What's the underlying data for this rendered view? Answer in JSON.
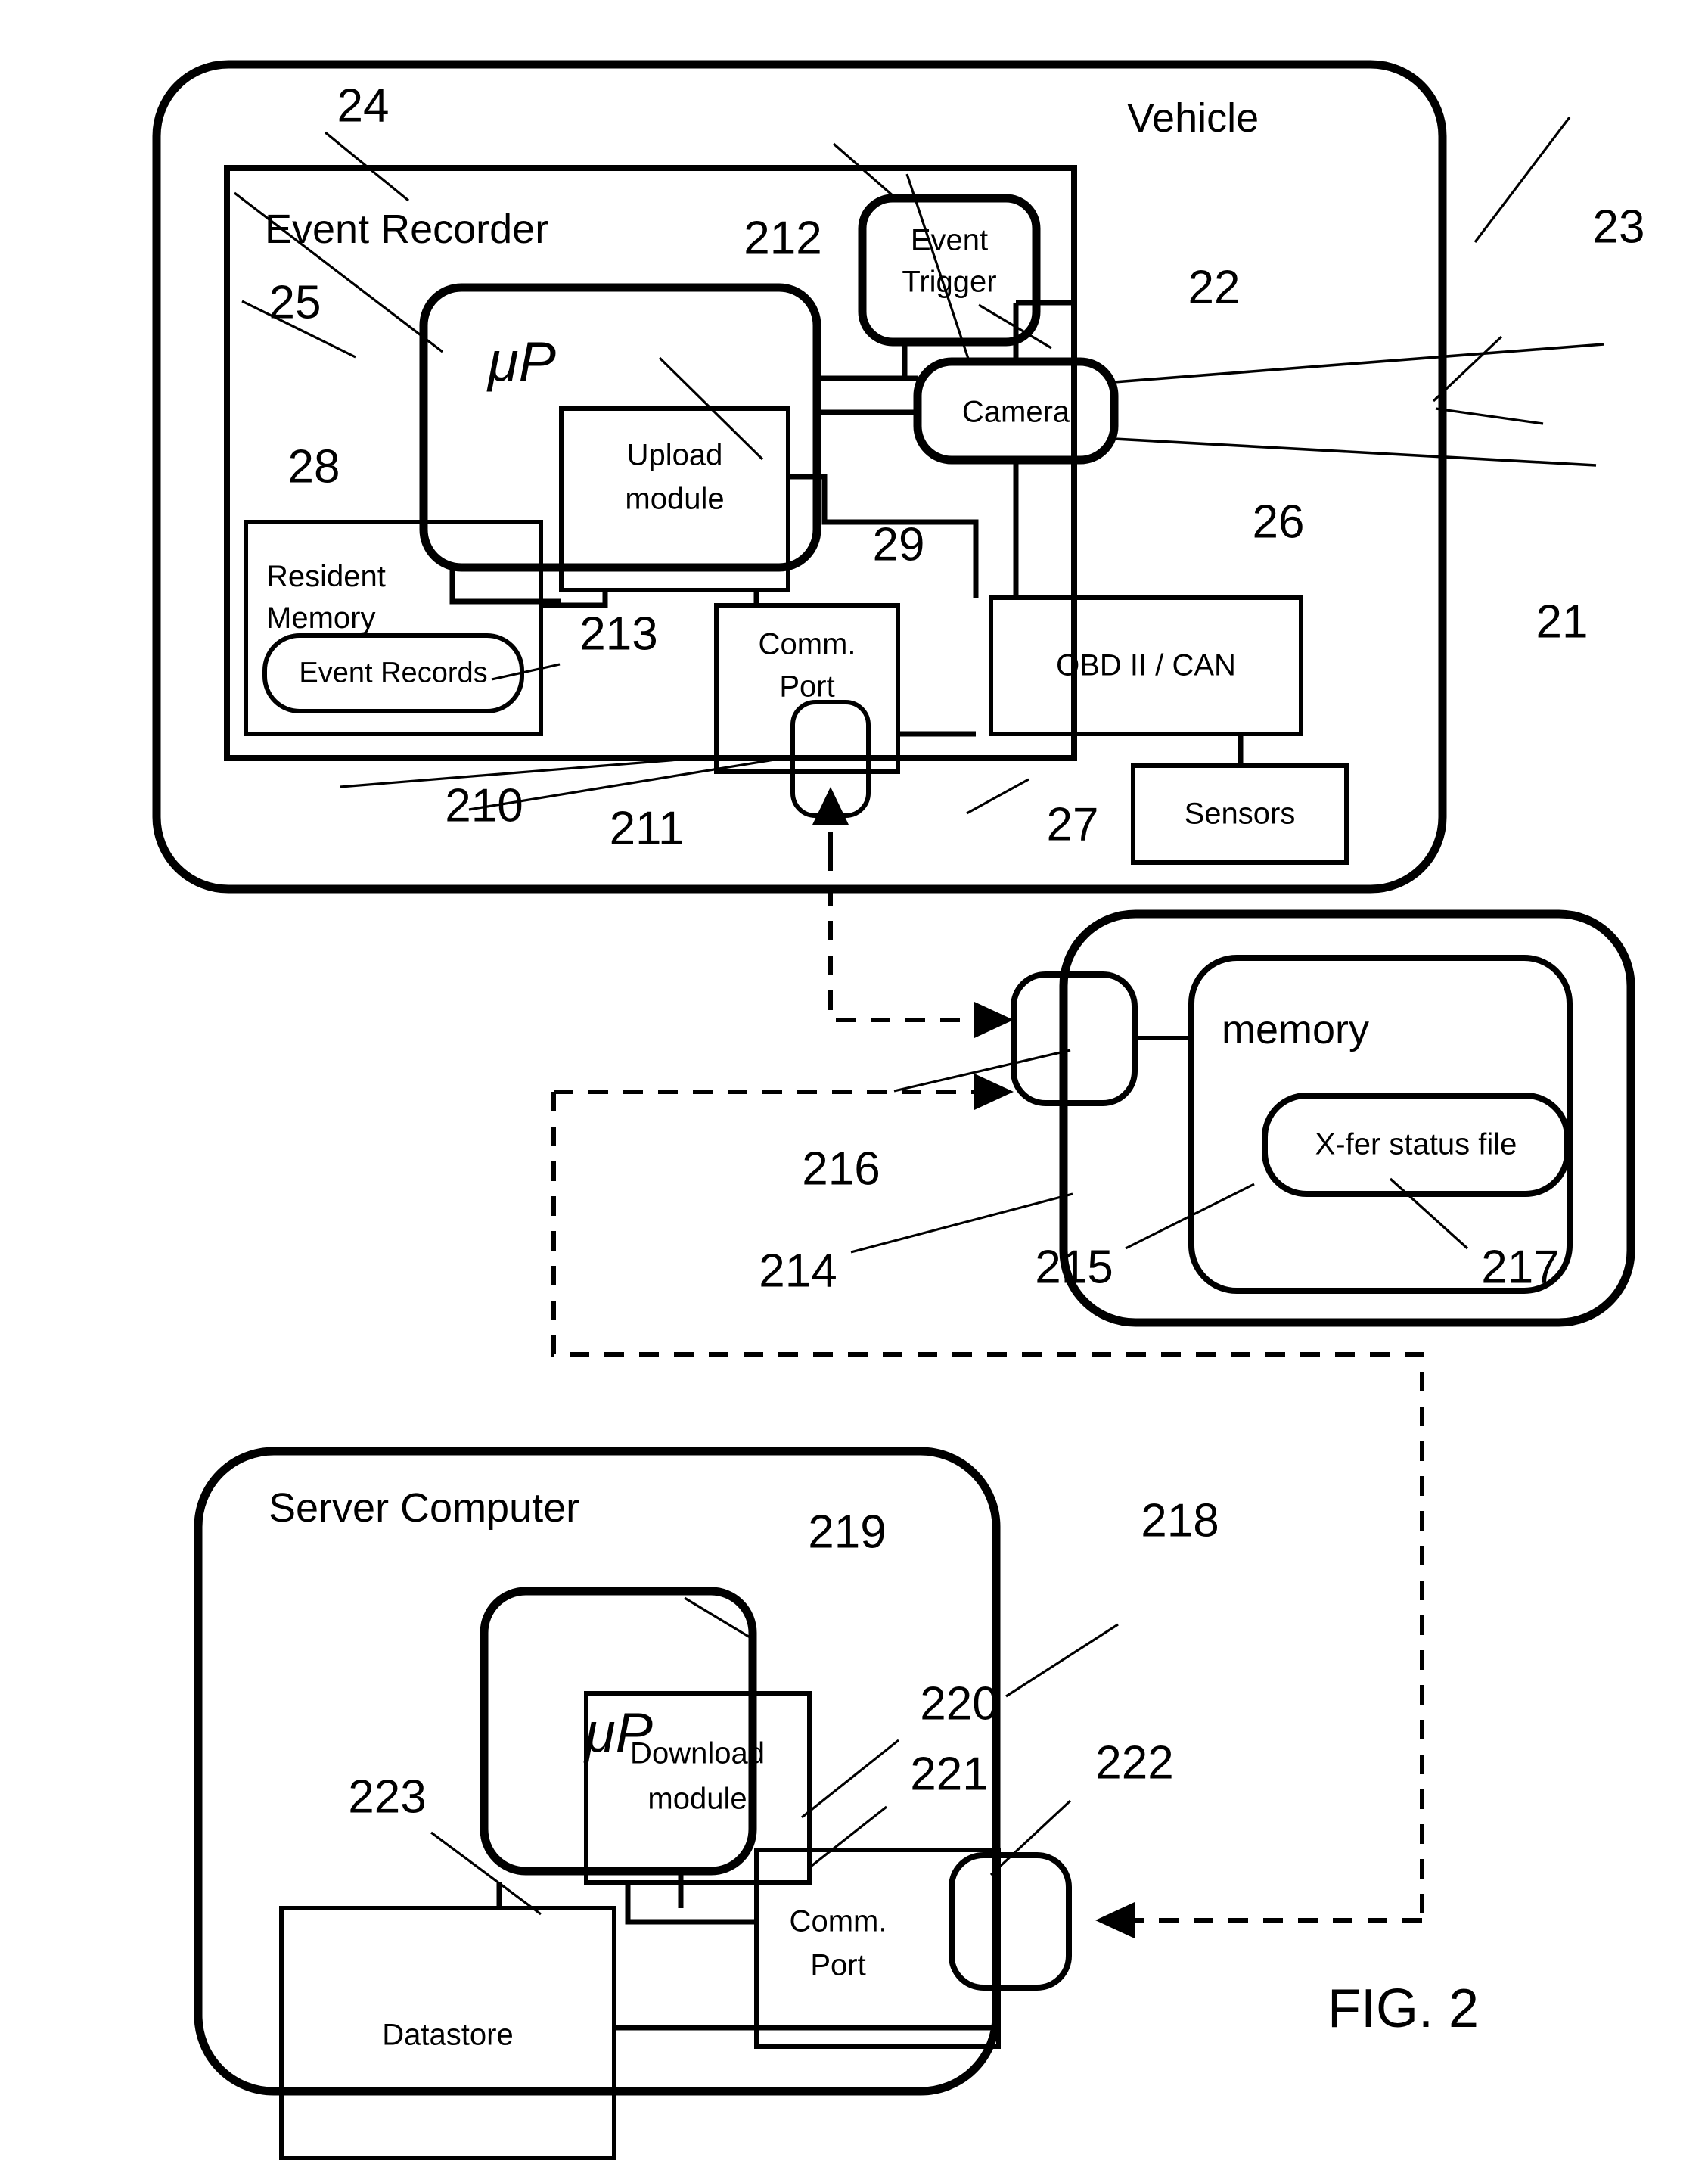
{
  "figure": {
    "caption": "FIG. 2",
    "vehicle": {
      "title": "Vehicle",
      "ref_vehicle": "21",
      "ref_fov": "23",
      "event_recorder": {
        "title": "Event Recorder",
        "ref": "24",
        "blocks": {
          "processor": {
            "label": "μP",
            "ref": "25"
          },
          "event_trigger": {
            "label_line1": "Event",
            "label_line2": "Trigger",
            "ref": "212"
          },
          "upload_module": {
            "label_line1": "Upload",
            "label_line2": "module",
            "ref": "29"
          },
          "resident_memory": {
            "label_line1": "Resident",
            "label_line2": "Memory",
            "ref": "28"
          },
          "event_records": {
            "label": "Event Records",
            "ref": "213"
          },
          "comm_port": {
            "label_line1": "Comm.",
            "label_line2": "Port",
            "ref": "210"
          },
          "comm_port_connector": {
            "ref": "211"
          }
        }
      },
      "camera": {
        "label": "Camera",
        "ref": "22"
      },
      "obd": {
        "label": "OBD II / CAN",
        "ref": "26"
      },
      "sensors": {
        "label": "Sensors",
        "ref": "27"
      }
    },
    "mobile_device": {
      "ref": "214",
      "memory": {
        "label": "memory",
        "ref": "215"
      },
      "xfer_status_file": {
        "label": "X-fer status file",
        "ref": "217"
      },
      "comm_port_connector": {
        "ref": "216"
      }
    },
    "server_computer": {
      "title": "Server Computer",
      "ref": "218",
      "blocks": {
        "processor": {
          "label": "μP",
          "ref": "219"
        },
        "download_module": {
          "label_line1": "Download",
          "label_line2": "module",
          "ref": "220"
        },
        "comm_port": {
          "label_line1": "Comm.",
          "label_line2": "Port",
          "ref": "221"
        },
        "comm_port_connector": {
          "ref": "222"
        },
        "datastore": {
          "label": "Datastore",
          "ref": "223"
        }
      }
    }
  }
}
